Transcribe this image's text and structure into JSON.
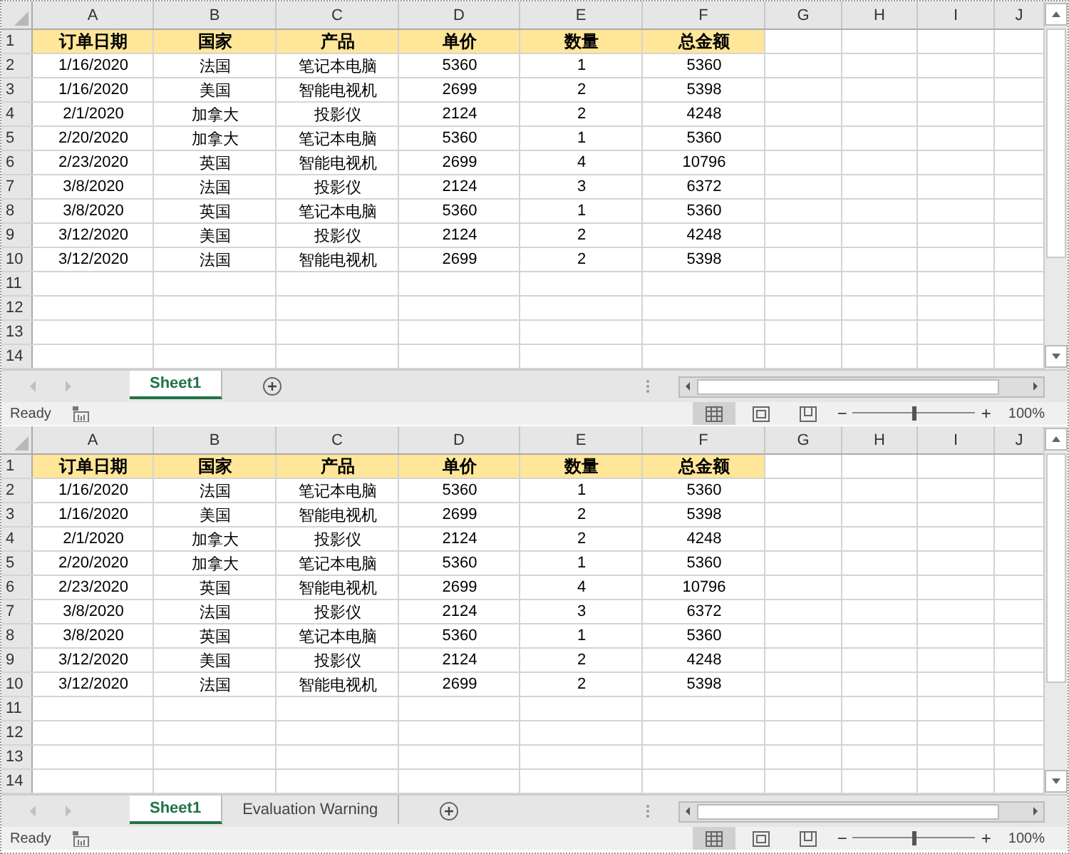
{
  "panes": [
    {
      "columns": [
        "A",
        "B",
        "C",
        "D",
        "E",
        "F",
        "G",
        "H",
        "I",
        "J"
      ],
      "row_numbers": [
        "1",
        "2",
        "3",
        "4",
        "5",
        "6",
        "7",
        "8",
        "9",
        "10",
        "11",
        "12",
        "13",
        "14"
      ],
      "rows": [
        [
          "订单日期",
          "国家",
          "产品",
          "单价",
          "数量",
          "总金额"
        ],
        [
          "1/16/2020",
          "法国",
          "笔记本电脑",
          "5360",
          "1",
          "5360"
        ],
        [
          "1/16/2020",
          "美国",
          "智能电视机",
          "2699",
          "2",
          "5398"
        ],
        [
          "2/1/2020",
          "加拿大",
          "投影仪",
          "2124",
          "2",
          "4248"
        ],
        [
          "2/20/2020",
          "加拿大",
          "笔记本电脑",
          "5360",
          "1",
          "5360"
        ],
        [
          "2/23/2020",
          "英国",
          "智能电视机",
          "2699",
          "4",
          "10796"
        ],
        [
          "3/8/2020",
          "法国",
          "投影仪",
          "2124",
          "3",
          "6372"
        ],
        [
          "3/8/2020",
          "英国",
          "笔记本电脑",
          "5360",
          "1",
          "5360"
        ],
        [
          "3/12/2020",
          "美国",
          "投影仪",
          "2124",
          "2",
          "4248"
        ],
        [
          "3/12/2020",
          "法国",
          "智能电视机",
          "2699",
          "2",
          "5398"
        ]
      ],
      "sheet_tabs": [
        {
          "label": "Sheet1",
          "selected": true
        }
      ],
      "status": "Ready",
      "views": [
        {
          "kind": "normal",
          "selected": true
        },
        {
          "kind": "page-layout",
          "selected": false
        },
        {
          "kind": "page-break",
          "selected": false
        }
      ],
      "zoom": {
        "minus": "−",
        "plus": "+",
        "level": 0.5,
        "reading": "100%"
      }
    },
    {
      "columns": [
        "A",
        "B",
        "C",
        "D",
        "E",
        "F",
        "G",
        "H",
        "I",
        "J"
      ],
      "row_numbers": [
        "1",
        "2",
        "3",
        "4",
        "5",
        "6",
        "7",
        "8",
        "9",
        "10",
        "11",
        "12",
        "13",
        "14"
      ],
      "rows": [
        [
          "订单日期",
          "国家",
          "产品",
          "单价",
          "数量",
          "总金额"
        ],
        [
          "1/16/2020",
          "法国",
          "笔记本电脑",
          "5360",
          "1",
          "5360"
        ],
        [
          "1/16/2020",
          "美国",
          "智能电视机",
          "2699",
          "2",
          "5398"
        ],
        [
          "2/1/2020",
          "加拿大",
          "投影仪",
          "2124",
          "2",
          "4248"
        ],
        [
          "2/20/2020",
          "加拿大",
          "笔记本电脑",
          "5360",
          "1",
          "5360"
        ],
        [
          "2/23/2020",
          "英国",
          "智能电视机",
          "2699",
          "4",
          "10796"
        ],
        [
          "3/8/2020",
          "法国",
          "投影仪",
          "2124",
          "3",
          "6372"
        ],
        [
          "3/8/2020",
          "英国",
          "笔记本电脑",
          "5360",
          "1",
          "5360"
        ],
        [
          "3/12/2020",
          "美国",
          "投影仪",
          "2124",
          "2",
          "4248"
        ],
        [
          "3/12/2020",
          "法国",
          "智能电视机",
          "2699",
          "2",
          "5398"
        ]
      ],
      "sheet_tabs": [
        {
          "label": "Sheet1",
          "selected": true
        },
        {
          "label": "Evaluation Warning",
          "selected": false
        }
      ],
      "status": "Ready",
      "views": [
        {
          "kind": "normal",
          "selected": true
        },
        {
          "kind": "page-layout",
          "selected": false
        },
        {
          "kind": "page-break",
          "selected": false
        }
      ],
      "zoom": {
        "minus": "−",
        "plus": "+",
        "level": 0.5,
        "reading": "100%"
      }
    }
  ]
}
